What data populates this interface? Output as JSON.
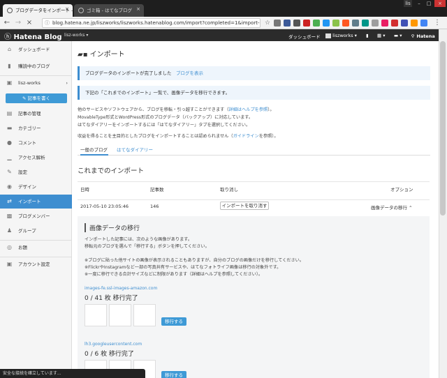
{
  "browser": {
    "tabs": [
      {
        "label": "ブログデータをインポート - はて"
      },
      {
        "label": "ゴミ箱 - はてなブログ"
      }
    ],
    "window_user": "lis",
    "url": "blog.hatena.ne.jp/liszworks/liszworks.hatenablog.com/import?completed=1&import-id=1",
    "status_text": "安全な接続を確立しています..."
  },
  "header": {
    "logo_text": "Hatena Blog",
    "blog_selector": "lisz-works",
    "dashboard": "ダッシュボード",
    "user": "liszworks",
    "hatena": "Hatena"
  },
  "sidebar": {
    "items": [
      {
        "label": "ダッシュボード",
        "icon": "home-icon"
      },
      {
        "label": "購読中のブログ",
        "icon": "bookmark-icon"
      },
      {
        "label": "lisz-works",
        "icon": "blog-icon"
      },
      {
        "label": "記事の管理",
        "icon": "document-icon"
      },
      {
        "label": "カテゴリー",
        "icon": "folder-icon"
      },
      {
        "label": "コメント",
        "icon": "comment-icon"
      },
      {
        "label": "アクセス解析",
        "icon": "chart-icon"
      },
      {
        "label": "設定",
        "icon": "wrench-icon"
      },
      {
        "label": "デザイン",
        "icon": "palette-icon"
      },
      {
        "label": "インポート",
        "icon": "import-icon"
      },
      {
        "label": "ブログメンバー",
        "icon": "members-icon"
      },
      {
        "label": "グループ",
        "icon": "group-icon"
      },
      {
        "label": "お題",
        "icon": "topic-icon"
      },
      {
        "label": "アカウント設定",
        "icon": "account-icon"
      }
    ],
    "write_button": "記事を書く"
  },
  "main": {
    "title": "インポート",
    "notice1": "ブログデータのインポートが完了しました",
    "notice1_link": "ブログを表示",
    "notice2": "下記の「これまでのインポート」一覧で、画像データを移行できます。",
    "desc1": "他のサービスやソフトウェアから、ブログを移転・引っ越すことができます（",
    "desc1_link": "詳細はヘルプを参照",
    "desc1_end": "）。",
    "desc2": "MovableType形式とWordPress形式のブログデータ（バックアップ）に対応しています。",
    "desc3": "はてなダイアリーをインポートするには「はてなダイアリー」タブを選択してください。",
    "desc4": "収益を得ることを主目的としたブログをインポートすることは認められません（",
    "desc4_link": "ガイドライン",
    "desc4_end": "を参照）。",
    "tab_general": "一般のブログ",
    "tab_diary": "はてなダイアリー",
    "history_title": "これまでのインポート",
    "table": {
      "headers": [
        "日時",
        "記事数",
        "取り消し",
        "オプション"
      ],
      "row": {
        "datetime": "2017-05-10 23:05:46",
        "count": "146",
        "cancel_button": "インポートを取り消す",
        "option": "画像データの移行"
      }
    },
    "panel": {
      "title": "画像データの移行",
      "p1": "インポートした記事には、次のような画像があります。",
      "p2": "移転元のブログを選んで「移行する」ボタンを押してください。",
      "n1": "※ブログに貼った他サイトの画像が表示されることもありますが、自分のブログの画像だけを移行してください。",
      "n2": "※FlickrやInstagramなど一部の写真共有サービスや、はてなフォトライフ画像は移行の対象外です。",
      "n3": "※一度に移行できる合計サイズなどに制限があります（詳細はヘルプを参照してください）。",
      "sources": [
        {
          "name": "images-fe.ssl-images-amazon.com",
          "progress": "0 / 41 枚 移行完了",
          "button": "移行する"
        },
        {
          "name": "lh3.googleusercontent.com",
          "progress": "0 / 6 枚 移行完了",
          "button": "移行する"
        }
      ]
    }
  }
}
